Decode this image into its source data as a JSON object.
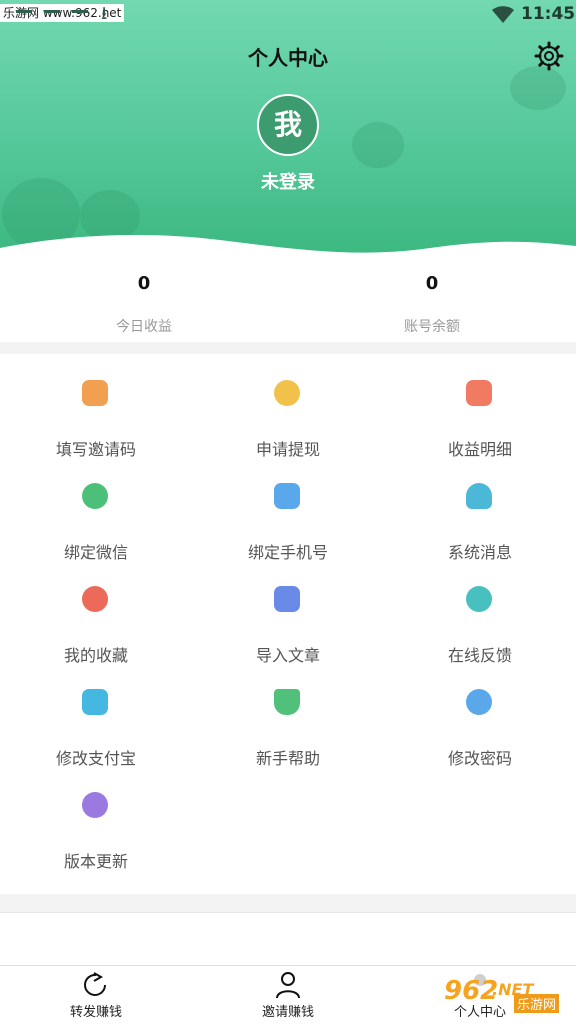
{
  "status_bar": {
    "watermark_text": "乐游网 www.962.net",
    "time": "11:45"
  },
  "header": {
    "title": "个人中心",
    "avatar_char": "我",
    "login_text": "未登录"
  },
  "stats": [
    {
      "value": "0",
      "label": "今日收益"
    },
    {
      "value": "0",
      "label": "账号余额"
    }
  ],
  "menu": [
    {
      "label": "填写邀请码",
      "icon": "invite-icon",
      "color": "#f0a050"
    },
    {
      "label": "申请提现",
      "icon": "coin-icon",
      "color": "#f2c14a"
    },
    {
      "label": "收益明细",
      "icon": "ledger-icon",
      "color": "#f07a62"
    },
    {
      "label": "绑定微信",
      "icon": "wechat-icon",
      "color": "#4cc078"
    },
    {
      "label": "绑定手机号",
      "icon": "phone-icon",
      "color": "#5aa8ec"
    },
    {
      "label": "系统消息",
      "icon": "bell-icon",
      "color": "#4bb8d8"
    },
    {
      "label": "我的收藏",
      "icon": "star-icon",
      "color": "#ec6a5a"
    },
    {
      "label": "导入文章",
      "icon": "import-icon",
      "color": "#6a8ae8"
    },
    {
      "label": "在线反馈",
      "icon": "chat-icon",
      "color": "#48c0c0"
    },
    {
      "label": "修改支付宝",
      "icon": "alipay-icon",
      "color": "#44b8e0"
    },
    {
      "label": "新手帮助",
      "icon": "hammer-icon",
      "color": "#50c07a"
    },
    {
      "label": "修改密码",
      "icon": "key-icon",
      "color": "#5aa8ea"
    },
    {
      "label": "版本更新",
      "icon": "refresh-icon",
      "color": "#9a7ae0"
    }
  ],
  "tabs": [
    {
      "label": "转发赚钱",
      "icon": "share-icon"
    },
    {
      "label": "邀请赚钱",
      "icon": "user-icon"
    },
    {
      "label": "个人中心",
      "icon": "profile-icon"
    }
  ],
  "watermark": {
    "number": "962",
    "tld": ".NET",
    "cn": "乐游网"
  }
}
